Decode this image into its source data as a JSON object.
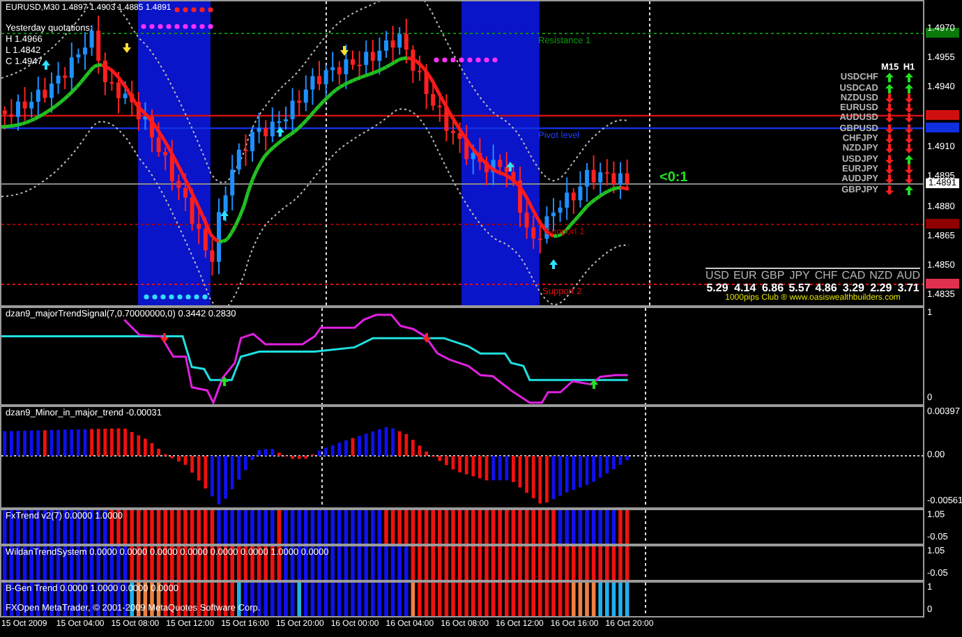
{
  "header": {
    "symbol": "EURUSD,M30",
    "quotes": [
      "1.4897",
      "1.4903",
      "1.4885",
      "1.4891"
    ]
  },
  "yesterday": {
    "title": "Yesterday quotations:",
    "lines": [
      "H 1.4966",
      "L 1.4842",
      "C 1.4947"
    ]
  },
  "levels": [
    {
      "kind": "resistance",
      "label": "Resistance 1"
    },
    {
      "kind": "pivot",
      "label": "Pivot level"
    },
    {
      "kind": "support",
      "label": "Support 1"
    },
    {
      "kind": "support2",
      "label": "Support 2"
    }
  ],
  "ratio": "<0:1",
  "pairs": {
    "columns": [
      "M15",
      "H1"
    ],
    "rows": [
      {
        "name": "USDCHF",
        "m15_up": true,
        "h1_up": true
      },
      {
        "name": "USDCAD",
        "m15_up": true,
        "h1_up": true
      },
      {
        "name": "NZDUSD",
        "m15_up": false,
        "h1_up": false
      },
      {
        "name": "EURUSD",
        "m15_up": false,
        "h1_up": false
      },
      {
        "name": "AUDUSD",
        "m15_up": false,
        "h1_up": false
      },
      {
        "name": "GBPUSD",
        "m15_up": false,
        "h1_up": false
      },
      {
        "name": "CHFJPY",
        "m15_up": false,
        "h1_up": false
      },
      {
        "name": "NZDJPY",
        "m15_up": false,
        "h1_up": false
      },
      {
        "name": "USDJPY",
        "m15_up": false,
        "h1_up": true
      },
      {
        "name": "EURJPY",
        "m15_up": false,
        "h1_up": false
      },
      {
        "name": "AUDJPY",
        "m15_up": false,
        "h1_up": false
      },
      {
        "name": "GBPJPY",
        "m15_up": false,
        "h1_up": true
      }
    ]
  },
  "strength": {
    "columns": [
      {
        "currency": "USD",
        "value": "5.29"
      },
      {
        "currency": "EUR",
        "value": "4.14"
      },
      {
        "currency": "GBP",
        "value": "6.86"
      },
      {
        "currency": "JPY",
        "value": "5.57"
      },
      {
        "currency": "CHF",
        "value": "4.86"
      },
      {
        "currency": "CAD",
        "value": "3.29"
      },
      {
        "currency": "NZD",
        "value": "2.29"
      },
      {
        "currency": "AUD",
        "value": "3.71"
      }
    ],
    "footer": "1000pips Club ® www.oasiswealthbuilders.com"
  },
  "price_axis": [
    "1.4970",
    "1.4955",
    "1.4940",
    "1.4910",
    "1.4895",
    "1.4880",
    "1.4865",
    "1.4850",
    "1.4835"
  ],
  "current_price": "1.4891",
  "indicators": [
    {
      "kind": "signal",
      "title": "dzan9_majorTrendSignal(7,0.70000000,0) 0.3442 0.2830",
      "axis": [
        "1",
        "0"
      ]
    },
    {
      "kind": "histogram",
      "title": "dzan9_Minor_in_major_trend -0.00031",
      "axis": [
        "0.00397",
        "0.00",
        "-0.00561"
      ]
    },
    {
      "kind": "trend",
      "title": "FxTrend v2(7) 0.0000 1.0000",
      "axis": [
        "1.05",
        "-0.05"
      ]
    },
    {
      "kind": "trend",
      "title": "WildanTrendSystem 0.0000 0.0000 0.0000 0.0000 0.0000 0.0000 1.0000 0.0000",
      "axis": [
        "1.05",
        "-0.05"
      ]
    },
    {
      "kind": "trend",
      "title": "B-Gen Trend 0.0000 1.0000 0.0000 0.0000",
      "axis": [
        "1",
        "0"
      ]
    }
  ],
  "copyright": "FXOpen MetaTrader, © 2001-2009 MetaQuotes Software Corp.",
  "time_axis": [
    "15 Oct 2009",
    "15 Oct 04:00",
    "15 Oct 08:00",
    "15 Oct 12:00",
    "15 Oct 16:00",
    "15 Oct 20:00",
    "16 Oct 00:00",
    "16 Oct 04:00",
    "16 Oct 08:00",
    "16 Oct 12:00",
    "16 Oct 16:00",
    "16 Oct 20:00"
  ]
}
